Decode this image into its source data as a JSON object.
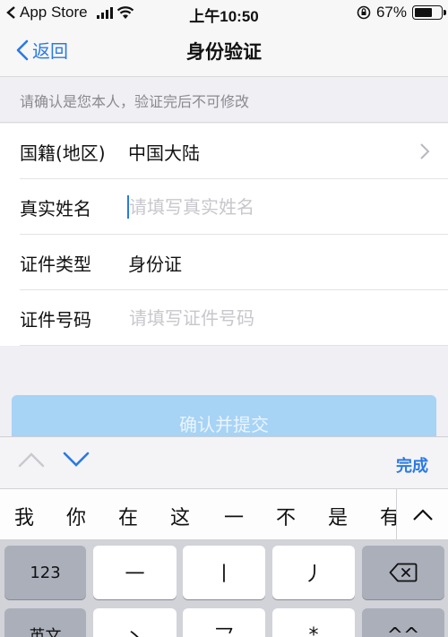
{
  "status_bar": {
    "carrier": "App Store",
    "time": "上午10:50",
    "battery": "67%",
    "battery_level": 0.67
  },
  "nav": {
    "back_label": "返回",
    "title": "身份验证"
  },
  "notice": "请确认是您本人，验证完后不可修改",
  "form": {
    "nationality_label": "国籍(地区)",
    "nationality_value": "中国大陆",
    "name_label": "真实姓名",
    "name_placeholder": "请填写真实姓名",
    "id_type_label": "证件类型",
    "id_type_value": "身份证",
    "id_number_label": "证件号码",
    "id_number_placeholder": "请填写证件号码"
  },
  "submit_label": "确认并提交",
  "keyboard_toolbar": {
    "done_label": "完成"
  },
  "candidates": [
    "我",
    "你",
    "在",
    "这",
    "一",
    "不",
    "是",
    "有"
  ],
  "keyboard": {
    "row1": [
      "123",
      "一",
      "丨",
      "丿"
    ],
    "row2": [
      "英文",
      "丶",
      "乛",
      "*",
      "^^"
    ]
  },
  "icons": {
    "back": "chevron-left-icon",
    "disclosure": "chevron-right-icon",
    "prev_field": "chevron-up-icon",
    "next_field": "chevron-down-icon",
    "expand": "chevron-up-icon",
    "delete": "backspace-icon"
  },
  "colors": {
    "accent": "#2a7ae4",
    "submit_disabled": "#a7d3f5"
  }
}
